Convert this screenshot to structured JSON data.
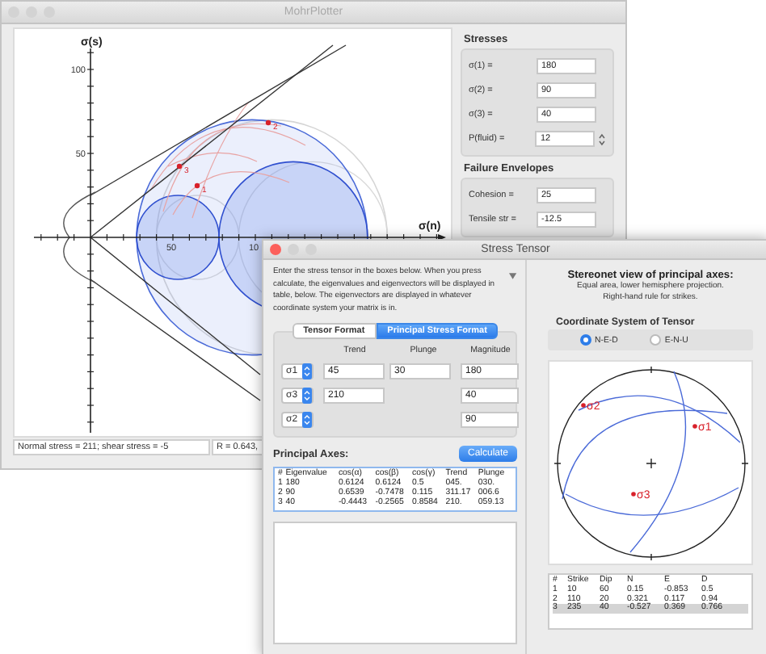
{
  "mohr_window": {
    "title": "MohrPlotter",
    "plot": {
      "y_axis_label": "σ(s)",
      "x_axis_label": "σ(n)",
      "y_ticks": [
        "100",
        "50"
      ],
      "x_ticks": [
        "50",
        "10"
      ],
      "point_labels": [
        "1",
        "2",
        "3"
      ]
    },
    "status": {
      "readout": "Normal stress = 211;  shear stress = -5",
      "ratio": "R = 0.643,"
    },
    "stresses": {
      "heading": "Stresses",
      "fields": [
        {
          "label": "σ(1) =",
          "value": "180",
          "kind": "text"
        },
        {
          "label": "σ(2) =",
          "value": "90",
          "kind": "text"
        },
        {
          "label": "σ(3) =",
          "value": "40",
          "kind": "text"
        },
        {
          "label": "P(fluid) =",
          "value": "12",
          "kind": "stepper"
        }
      ]
    },
    "failure_envelopes": {
      "heading": "Failure Envelopes",
      "fields": [
        {
          "label": "Cohesion =",
          "value": "25",
          "kind": "text"
        },
        {
          "label": "Tensile str =",
          "value": "-12.5",
          "kind": "text"
        }
      ]
    }
  },
  "stress_tensor_window": {
    "title": "Stress Tensor",
    "instructions": "Enter the stress tensor in the boxes below.  When you press calculate, the eigenvalues and eigenvectors will be displayed in table, below. The eigenvectors are displayed in whatever coordinate system your matrix is in.",
    "format_tabs": [
      {
        "label": "Tensor Format",
        "selected": false
      },
      {
        "label": "Principal Stress Format",
        "selected": true
      }
    ],
    "columns": [
      "Trend",
      "Plunge",
      "Magnitude"
    ],
    "axes": [
      {
        "axis": "σ1",
        "trend": "45",
        "plunge": "30",
        "magnitude": "180"
      },
      {
        "axis": "σ3",
        "trend": "210",
        "magnitude": "40"
      },
      {
        "axis": "σ2",
        "magnitude": "90"
      }
    ],
    "principal_axes": {
      "heading": "Principal Axes:",
      "button": "Calculate",
      "columns": [
        "#",
        "Eigenvalue",
        "cos(α)",
        "cos(β)",
        "cos(γ)",
        "Trend",
        "Plunge"
      ],
      "rows": [
        [
          "1",
          "180",
          "0.6124",
          "0.6124",
          "0.5",
          "045.",
          "030."
        ],
        [
          "2",
          "90",
          "0.6539",
          "-0.7478",
          "0.115",
          "311.17",
          "006.6"
        ],
        [
          "3",
          "40",
          "-0.4443",
          "-0.2565",
          "0.8584",
          "210.",
          "059.13"
        ]
      ]
    },
    "stereonet": {
      "heading": "Stereonet view of principal axes:",
      "notes": [
        "Equal area, lower hemisphere projection.",
        "Right-hand rule for strikes."
      ],
      "coordinate_heading": "Coordinate System of Tensor",
      "coordinate_systems": [
        {
          "label": "N-E-D",
          "selected": true
        },
        {
          "label": "E-N-U",
          "selected": false
        }
      ],
      "points": [
        "σ2",
        "σ1",
        "σ3"
      ],
      "planes": {
        "columns": [
          "#",
          "Strike",
          "Dip",
          "N",
          "E",
          "D"
        ],
        "rows": [
          {
            "cells": [
              "1",
              "10",
              "60",
              "0.15",
              "-0.853",
              "0.5"
            ],
            "selected": false
          },
          {
            "cells": [
              "2",
              "110",
              "20",
              "0.321",
              "0.117",
              "0.94"
            ],
            "selected": false
          },
          {
            "cells": [
              "3",
              "235",
              "40",
              "-0.527",
              "0.369",
              "0.766"
            ],
            "selected": true
          }
        ]
      }
    }
  }
}
